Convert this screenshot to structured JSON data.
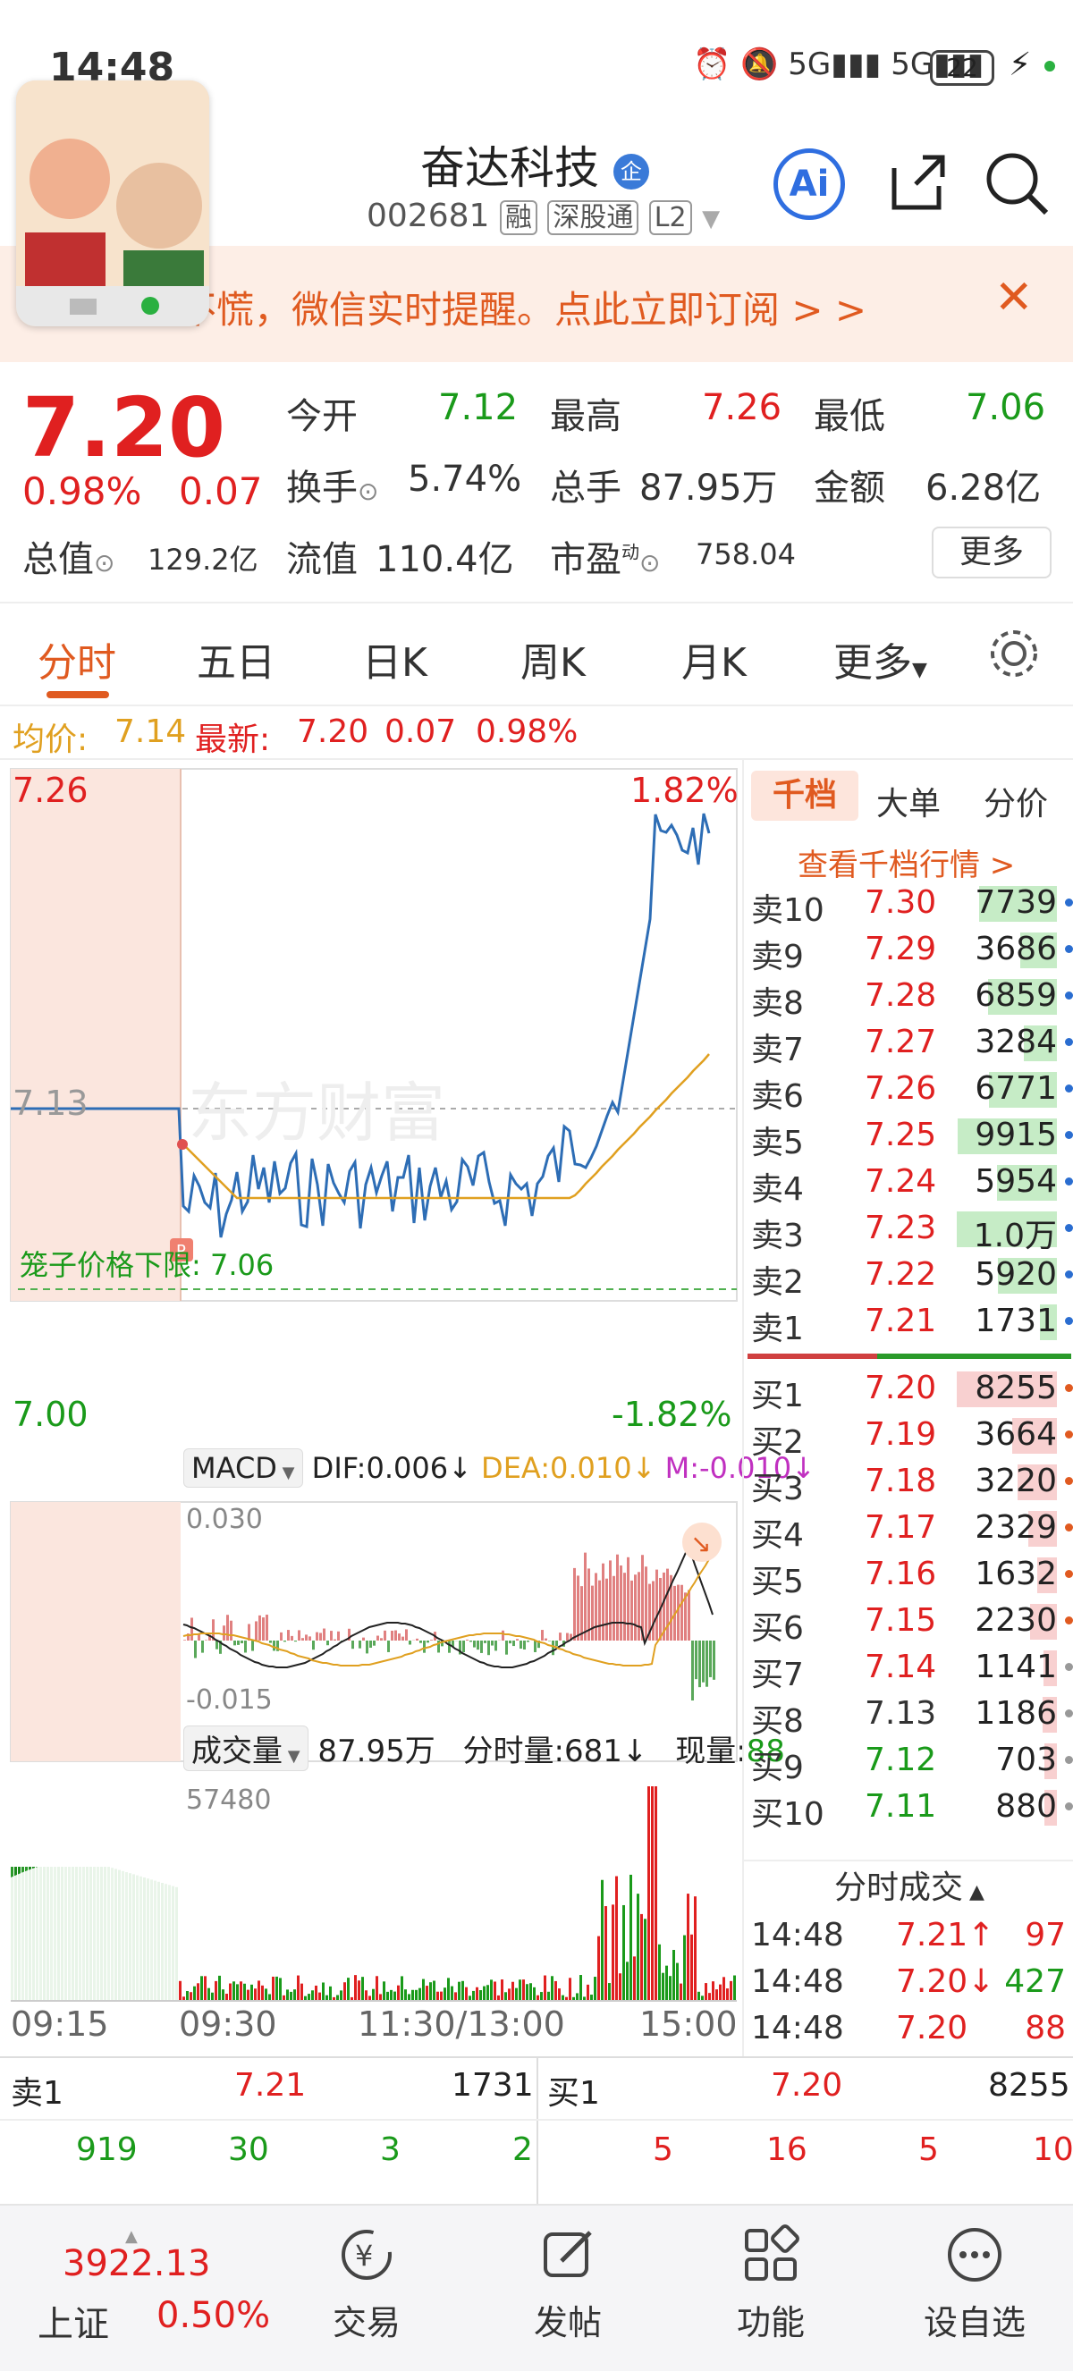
{
  "status": {
    "time": "14:48",
    "battery": "22"
  },
  "header": {
    "title": "奋达科技",
    "badge": "企",
    "code": "002681",
    "tags": [
      "融",
      "深股通",
      "L2"
    ]
  },
  "banner": {
    "text": "不慌，微信实时提醒。点此立即订阅 > >"
  },
  "quote": {
    "price": "7.20",
    "pct": "0.98%",
    "chg": "0.07",
    "open_label": "今开",
    "open": "7.12",
    "high_label": "最高",
    "high": "7.26",
    "low_label": "最低",
    "low": "7.06",
    "turnover_label": "换手",
    "turnover": "5.74%",
    "vol_label": "总手",
    "vol": "87.95万",
    "amt_label": "金额",
    "amt": "6.28亿",
    "mcap_label": "总值",
    "mcap": "129.2亿",
    "float_label": "流值",
    "float": "110.4亿",
    "pe_label": "市盈",
    "pe_sup": "动",
    "pe": "758.04",
    "more": "更多"
  },
  "tabs": [
    "分时",
    "五日",
    "日K",
    "周K",
    "月K",
    "更多"
  ],
  "info": {
    "avg_label": "均价:",
    "avg": "7.14",
    "latest_label": "最新:",
    "latest": "7.20",
    "chg": "0.07",
    "pct": "0.98%"
  },
  "chart": {
    "y_top": "7.26",
    "y_mid": "7.13",
    "y_bot": "7.00",
    "pct_top": "1.82%",
    "pct_bot": "-1.82%",
    "limit_label": "笼子价格下限:",
    "limit_val": "7.06",
    "watermark": "东方财富",
    "macd_label": "MACD",
    "dif": "DIF:0.006↓",
    "dea": "DEA:0.010↓",
    "m": "M:-0.010↓",
    "macd_top": "0.030",
    "macd_bot": "-0.015",
    "vol_label": "成交量",
    "vol_total": "87.95万",
    "vol_min": "分时量:681↓",
    "vol_now_label": "现量:",
    "vol_now": "88",
    "vol_max": "57480",
    "x_labels": [
      "09:15",
      "09:30",
      "11:30/13:00",
      "15:00"
    ],
    "colors": {
      "price": "#2d6db5",
      "avg": "#e0a020",
      "up": "#e02020",
      "down": "#1a9a1a"
    }
  },
  "orderbook": {
    "tabs": [
      "千档",
      "大单",
      "分价"
    ],
    "link": "查看千档行情 >",
    "asks": [
      {
        "l": "卖10",
        "p": "7.30",
        "v": "7739"
      },
      {
        "l": "卖9",
        "p": "7.29",
        "v": "3686"
      },
      {
        "l": "卖8",
        "p": "7.28",
        "v": "6859"
      },
      {
        "l": "卖7",
        "p": "7.27",
        "v": "3284"
      },
      {
        "l": "卖6",
        "p": "7.26",
        "v": "6771"
      },
      {
        "l": "卖5",
        "p": "7.25",
        "v": "9915"
      },
      {
        "l": "卖4",
        "p": "7.24",
        "v": "5954"
      },
      {
        "l": "卖3",
        "p": "7.23",
        "v": "1.0万"
      },
      {
        "l": "卖2",
        "p": "7.22",
        "v": "5920"
      },
      {
        "l": "卖1",
        "p": "7.21",
        "v": "1731"
      }
    ],
    "bids": [
      {
        "l": "买1",
        "p": "7.20",
        "v": "8255"
      },
      {
        "l": "买2",
        "p": "7.19",
        "v": "3664"
      },
      {
        "l": "买3",
        "p": "7.18",
        "v": "3220"
      },
      {
        "l": "买4",
        "p": "7.17",
        "v": "2329"
      },
      {
        "l": "买5",
        "p": "7.16",
        "v": "1632"
      },
      {
        "l": "买6",
        "p": "7.15",
        "v": "2230"
      },
      {
        "l": "买7",
        "p": "7.14",
        "v": "1141"
      },
      {
        "l": "买8",
        "p": "7.13",
        "v": "1186"
      },
      {
        "l": "买9",
        "p": "7.12",
        "v": "703"
      },
      {
        "l": "买10",
        "p": "7.11",
        "v": "880"
      }
    ],
    "trades_title": "分时成交",
    "trades": [
      {
        "t": "14:48",
        "p": "7.21↑",
        "v": "97"
      },
      {
        "t": "14:48",
        "p": "7.20↓",
        "v": "427"
      },
      {
        "t": "14:48",
        "p": "7.20",
        "v": "88"
      }
    ]
  },
  "bottom": {
    "sell_label": "卖1",
    "sell_price": "7.21",
    "sell_vol": "1731",
    "buy_label": "买1",
    "buy_price": "7.20",
    "buy_vol": "8255",
    "sell_row": [
      "919",
      "30",
      "3",
      "2"
    ],
    "buy_row": [
      "5",
      "16",
      "5",
      "10"
    ]
  },
  "nav": {
    "index_val": "3922.13",
    "index_name": "上证",
    "index_pct": "0.50%",
    "items": [
      "交易",
      "发帖",
      "功能",
      "设自选"
    ]
  }
}
